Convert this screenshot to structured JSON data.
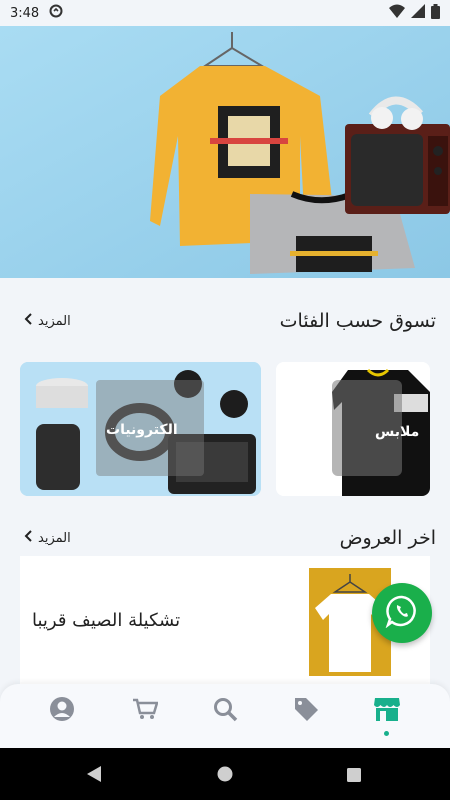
{
  "status_bar": {
    "time": "3:48"
  },
  "categories_section": {
    "title": "تسوق حسب الفئات",
    "more_label": "المزيد",
    "items": [
      {
        "label": "ملابس"
      },
      {
        "label": "الكترونيات"
      }
    ]
  },
  "offers_section": {
    "title": "اخر العروض",
    "more_label": "المزيد",
    "items": [
      {
        "title": "تشكيلة الصيف قريبا"
      }
    ]
  },
  "bottom_nav": {
    "items": [
      {
        "icon": "profile-icon"
      },
      {
        "icon": "cart-icon"
      },
      {
        "icon": "search-icon"
      },
      {
        "icon": "tag-icon"
      },
      {
        "icon": "store-icon",
        "active": true
      }
    ]
  },
  "colors": {
    "accent": "#18b08c",
    "whatsapp": "#1aaf4b",
    "background": "#f2f5f9"
  }
}
